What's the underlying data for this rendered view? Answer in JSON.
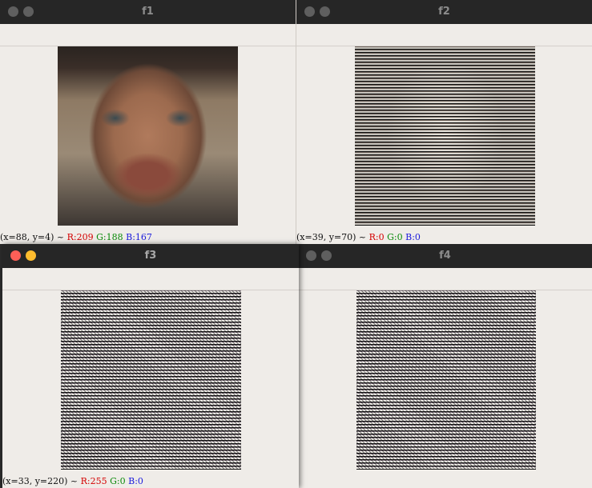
{
  "windows": [
    {
      "title": "f1",
      "status": {
        "coords": "(x=88, y=4) ~",
        "r": "R:209",
        "g": "G:188",
        "b": "B:167"
      }
    },
    {
      "title": "f2",
      "status": {
        "coords": "(x=39, y=70) ~",
        "r": "R:0",
        "g": "G:0",
        "b": "B:0"
      }
    },
    {
      "title": "f3",
      "status": {
        "coords": "(x=33, y=220) ~",
        "r": "R:255",
        "g": "G:0",
        "b": "B:0"
      }
    },
    {
      "title": "f4",
      "status": {
        "coords": "",
        "r": "",
        "g": "",
        "b": ""
      }
    }
  ],
  "colors": {
    "titlebar": "#262626",
    "window_bg": "#efece8",
    "close_active": "#fe5f57",
    "minimize_active": "#febc2e",
    "inactive_light": "#5f5f5f"
  },
  "icons": [
    "close-icon",
    "minimize-icon"
  ]
}
